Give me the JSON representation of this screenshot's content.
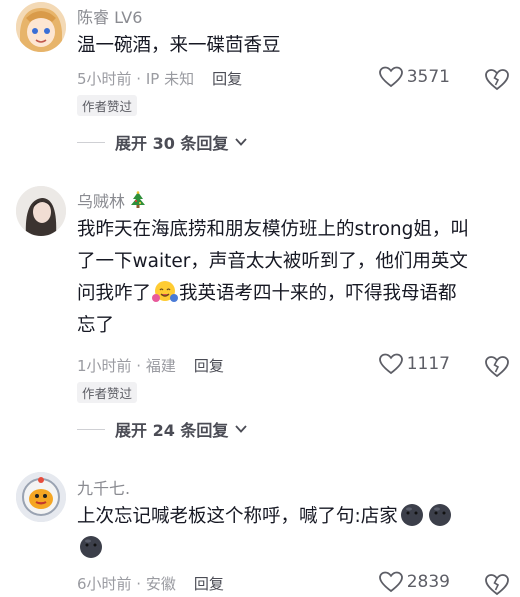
{
  "comments": [
    {
      "username": "陈睿 LV6",
      "text": "温一碗酒，来一碟茴香豆",
      "time_location": "5小时前 · IP 未知",
      "reply_label": "回复",
      "likes": "3571",
      "author_badge": "作者赞过",
      "expand_label": "展开 30 条回复",
      "avatar_icon": "anime-girl-avatar"
    },
    {
      "username": "乌贼林",
      "username_icon": "christmas-tree-icon",
      "text_lines": [
        "我昨天在海底捞和朋友模仿班上的strong姐，叫",
        "了一下waiter，声音太大被听到了，他们用英文",
        "问我咋了",
        "我英语考四十来的，吓得我母语都",
        "忘了"
      ],
      "inline_emoji": "hugging-face-emoji",
      "time_location": "1小时前 · 福建",
      "reply_label": "回复",
      "likes": "1117",
      "author_badge": "作者赞过",
      "expand_label": "展开 24 条回复",
      "avatar_icon": "girl-photo-avatar"
    },
    {
      "username": "九千七.",
      "text_line1": "上次忘记喊老板这个称呼，喊了句:店家",
      "inline_emoji": "dark-face-emoji",
      "time_location": "6小时前 · 安徽",
      "reply_label": "回复",
      "likes": "2839",
      "avatar_icon": "astronaut-bird-avatar"
    }
  ],
  "colors": {
    "text": "#161823",
    "meta": "#9a9ba1",
    "name": "#8a8b91"
  }
}
